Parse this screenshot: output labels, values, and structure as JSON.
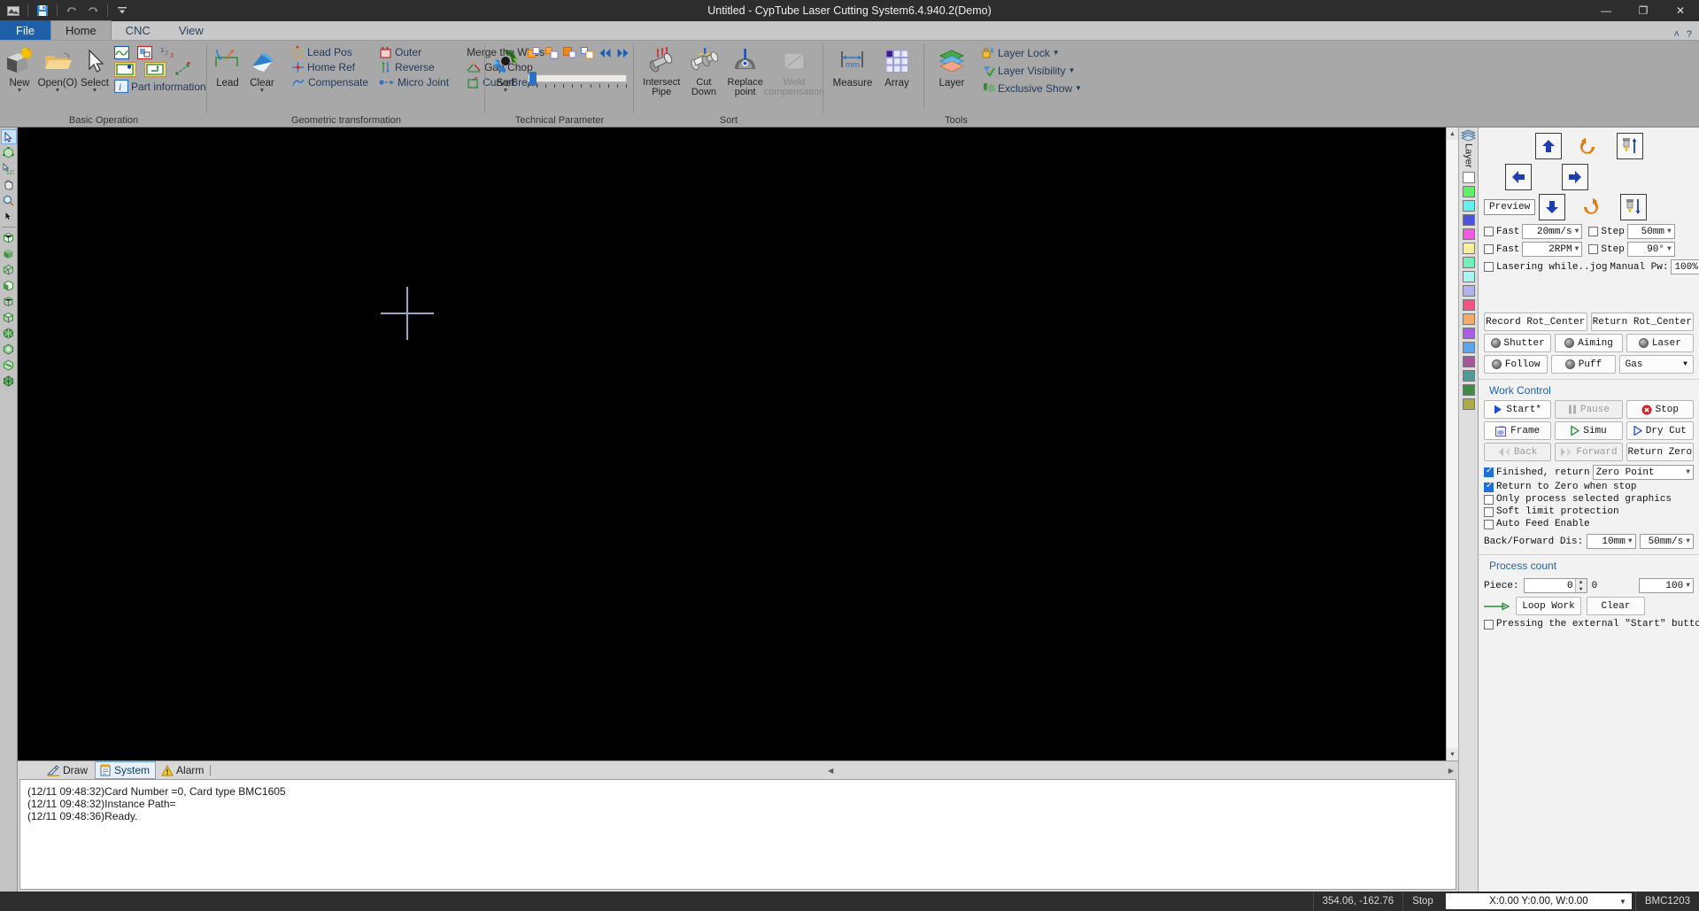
{
  "titlebar": {
    "title": "Untitled - CypTube Laser Cutting System6.4.940.2(Demo)",
    "quick_access": [
      "app-icon",
      "save-icon",
      "undo-icon",
      "redo-icon",
      "customize-icon"
    ],
    "minimize": "—",
    "maximize": "❐",
    "close": "✕"
  },
  "tabs": [
    {
      "label": "File",
      "kind": "file"
    },
    {
      "label": "Home",
      "kind": "active"
    },
    {
      "label": "CNC",
      "kind": "normal"
    },
    {
      "label": "View",
      "kind": "normal"
    }
  ],
  "tabstrip_right": {
    "help": "?",
    "collapse": "˄"
  },
  "ribbon": {
    "groups": [
      {
        "title": "Basic Operation",
        "big": [
          {
            "label": "New",
            "icon": "new-document-icon",
            "caret": true
          },
          {
            "label": "Open(O)",
            "icon": "open-folder-icon",
            "caret": true
          },
          {
            "label": "Select",
            "icon": "cursor-arrow-icon",
            "caret": true
          }
        ],
        "small": [
          {
            "label": "",
            "icon": "curve-icon"
          },
          {
            "label": "",
            "icon": "frame-select-icon"
          },
          {
            "label": "",
            "icon": "number-order-icon"
          },
          {
            "label": "",
            "icon": "start-point-icon"
          },
          {
            "label": "",
            "icon": "direction-icon"
          },
          {
            "label": "",
            "icon": "node-icon"
          },
          {
            "label": "Part information",
            "icon": "part-info-icon"
          }
        ]
      },
      {
        "title": "Geometric transformation",
        "big": [
          {
            "label": "Lead",
            "icon": "lead-icon",
            "caret": false
          },
          {
            "label": "Clear",
            "icon": "eraser-icon",
            "caret": true
          }
        ],
        "small_cols": [
          [
            {
              "label": "Lead Pos",
              "icon": "lead-pos-icon"
            },
            {
              "label": "Home Ref",
              "icon": "home-ref-icon"
            },
            {
              "label": "Compensate",
              "icon": "compensate-icon"
            }
          ],
          [
            {
              "label": "Outer",
              "icon": "outer-icon"
            },
            {
              "label": "Reverse",
              "icon": "reverse-icon"
            },
            {
              "label": "Micro Joint",
              "icon": "micro-joint-icon"
            }
          ],
          [
            {
              "label": "Merge the Wires",
              "icon": "merge-wires-icon"
            },
            {
              "label": "Gap   Chop",
              "icon": "gap-chop-icon"
            },
            {
              "label": "CurveBreak",
              "icon": "curve-break-icon"
            }
          ]
        ]
      },
      {
        "title": "Technical Parameter",
        "big": [
          {
            "label": "Sort",
            "icon": "sort-circular-icon",
            "caret": true
          }
        ],
        "icons": [
          "sort-a-icon",
          "sort-b-icon",
          "sort-c-icon",
          "sort-d-icon",
          "prev-icon",
          "next-icon"
        ],
        "slider": {
          "value": 2,
          "ticks": 12
        }
      },
      {
        "title": "Sort",
        "big": [
          {
            "label": "Intersect Pipe",
            "icon": "intersect-pipe-icon"
          },
          {
            "label": "Cut Down",
            "icon": "cut-down-icon"
          },
          {
            "label": "Replace point",
            "icon": "replace-point-icon"
          },
          {
            "label": "Weld compensation",
            "icon": "weld-compensation-icon",
            "disabled": true
          }
        ]
      },
      {
        "title": "Tools",
        "big": [
          {
            "label": "Measure",
            "icon": "measure-mm-icon"
          },
          {
            "label": "Array",
            "icon": "array-grid-icon"
          },
          {
            "label": "Layer",
            "icon": "layer-stack-icon"
          }
        ],
        "small_right": [
          {
            "label": "Layer Lock",
            "icon": "layer-lock-icon",
            "caret": true
          },
          {
            "label": "Layer Visibility",
            "icon": "layer-visibility-icon",
            "caret": true
          },
          {
            "label": "Exclusive Show",
            "icon": "exclusive-show-icon",
            "caret": true
          }
        ]
      }
    ]
  },
  "left_toolbar": [
    {
      "name": "select-tool",
      "selected": true
    },
    {
      "name": "node-edit-tool",
      "selected": false
    },
    {
      "name": "order-number-tool",
      "selected": false
    },
    {
      "name": "pan-hand-tool",
      "selected": false
    },
    {
      "name": "zoom-magnifier-tool",
      "selected": false
    },
    {
      "name": "pointer-small-tool",
      "selected": false
    },
    {
      "name": "view-iso-tool",
      "selected": false
    },
    {
      "name": "view-solid-tool",
      "selected": false
    },
    {
      "name": "view-wire-tool",
      "selected": false
    },
    {
      "name": "view-front-tool",
      "selected": false
    },
    {
      "name": "view-side-tool",
      "selected": false
    },
    {
      "name": "view-top-tool",
      "selected": false
    },
    {
      "name": "view-unfold-a-tool",
      "selected": false
    },
    {
      "name": "view-unfold-b-tool",
      "selected": false
    },
    {
      "name": "view-unfold-c-tool",
      "selected": false
    },
    {
      "name": "view-unfold-d-tool",
      "selected": false
    }
  ],
  "layer_panel": {
    "label": "Layer",
    "colors": [
      "#ffffff",
      "#5ef264",
      "#62f0ef",
      "#4a52e0",
      "#f258e0",
      "#f6f09a",
      "#6ef0b6",
      "#a8f4f4",
      "#b0b2ee",
      "#f2547f",
      "#f7a96a",
      "#ab5ce8",
      "#5aa6ee",
      "#a3569c",
      "#4c9a9a",
      "#3f8a44",
      "#b0a947"
    ]
  },
  "log": {
    "tabs": [
      {
        "label": "Draw",
        "icon": "draw-icon",
        "active": false
      },
      {
        "label": "System",
        "icon": "system-icon",
        "active": true
      },
      {
        "label": "Alarm",
        "icon": "alarm-icon",
        "active": false
      }
    ],
    "lines": [
      "(12/11 09:48:32)Card Number =0, Card type BMC1605",
      "(12/11 09:48:32)Instance Path=",
      "(12/11 09:48:36)Ready."
    ]
  },
  "right_panel": {
    "preview_label": "Preview",
    "jog": {
      "up": "up-arrow-icon",
      "down": "down-arrow-icon",
      "left": "left-arrow-icon",
      "right": "right-arrow-icon",
      "rotate_ccw": "rotate-ccw-icon",
      "rotate_cw": "rotate-cw-icon",
      "z_up": "nozzle-up-icon",
      "z_down": "nozzle-down-icon"
    },
    "speed_rows": [
      {
        "check_label": "Fast",
        "checked": false,
        "value": "20mm/s",
        "step_label": "Step",
        "step_checked": false,
        "step_value": "50mm"
      },
      {
        "check_label": "Fast",
        "checked": false,
        "value": "2RPM",
        "step_label": "Step",
        "step_checked": false,
        "step_value": "90°"
      }
    ],
    "lasering_row": {
      "label": "Lasering while..jog",
      "checked": false,
      "manual_label": "Manual Pw:",
      "manual_value": "100%"
    },
    "rot_buttons": [
      {
        "label": "Record Rot_Center"
      },
      {
        "label": "Return Rot_Center"
      }
    ],
    "toggle_buttons": [
      {
        "label": "Shutter",
        "indicator": true
      },
      {
        "label": "Aiming",
        "indicator": true
      },
      {
        "label": "Laser",
        "indicator": true
      },
      {
        "label": "Follow",
        "indicator": true
      },
      {
        "label": "Puff",
        "indicator": true
      },
      {
        "label": "Gas",
        "indicator": false,
        "dropdown": true
      }
    ],
    "work_control": {
      "title": "Work Control",
      "buttons": [
        {
          "label": "Start*",
          "icon": "play-blue-icon",
          "disabled": false
        },
        {
          "label": "Pause",
          "icon": "pause-icon",
          "disabled": true
        },
        {
          "label": "Stop",
          "icon": "stop-red-icon",
          "disabled": false
        },
        {
          "label": "Frame",
          "icon": "frame-icon",
          "disabled": false
        },
        {
          "label": "Simu",
          "icon": "simu-green-icon",
          "disabled": false
        },
        {
          "label": "Dry Cut",
          "icon": "dry-cut-icon",
          "disabled": false
        },
        {
          "label": "Back",
          "icon": "back-icon",
          "disabled": true
        },
        {
          "label": "Forward",
          "icon": "forward-icon",
          "disabled": true
        },
        {
          "label": "Return Zero",
          "icon": "",
          "disabled": false
        }
      ],
      "options": [
        {
          "label": "Finished, return",
          "checked": true,
          "combo": "Zero Point"
        },
        {
          "label": "Return to Zero when stop",
          "checked": true
        },
        {
          "label": "Only process selected graphics",
          "checked": false
        },
        {
          "label": "Soft limit protection",
          "checked": false
        },
        {
          "label": "Auto Feed Enable",
          "checked": false
        }
      ],
      "back_forward": {
        "label": "Back/Forward Dis:",
        "dist": "10mm",
        "speed": "50mm/s"
      }
    },
    "process_count": {
      "title": "Process count",
      "piece_label": "Piece:",
      "piece_value": "0",
      "piece_total": "0",
      "limit": "100",
      "loop_label": "Loop Work",
      "clear_label": "Clear",
      "external_label": "Pressing the external \"Start\" button",
      "external_checked": false
    }
  },
  "statusbar": {
    "coords": "354.06, -162.76",
    "state": "Stop",
    "origin": "X:0.00 Y:0.00, W:0.00",
    "card": "BMC1203"
  },
  "colors": {
    "accent_blue": "#1f5fae",
    "canvas_bg": "#000000",
    "ribbon_bg": "#a8a8a8",
    "titlebar_bg": "#2d2d2d"
  }
}
